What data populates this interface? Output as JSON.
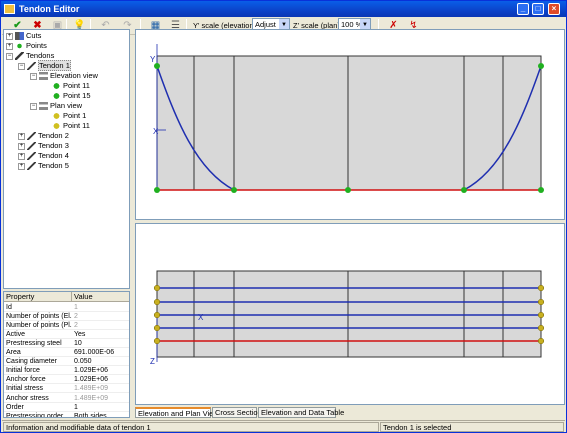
{
  "window": {
    "title": "Tendon Editor",
    "min": "_",
    "max": "□",
    "close": "×"
  },
  "toolbar": {
    "elevation_label": "Y' scale (elevation)",
    "elevation_value": "Adjust",
    "plan_label": "Z' scale (plan)",
    "plan_value": "100 %",
    "icons": [
      "check-icon",
      "delete-icon",
      "copy-icon",
      "bulb-icon",
      "undo-icon",
      "redo-icon",
      "calculator-icon",
      "list-icon",
      "ruler-cross-icon",
      "ruler-icon"
    ]
  },
  "tree": {
    "items": [
      {
        "label": "Cuts",
        "level": 0,
        "pm": "+"
      },
      {
        "label": "Points",
        "level": 0,
        "pm": "+"
      },
      {
        "label": "Tendons",
        "level": 0,
        "pm": "−"
      },
      {
        "label": "Tendon 1",
        "level": 1,
        "pm": "−"
      },
      {
        "label": "Elevation view",
        "level": 2,
        "pm": "−"
      },
      {
        "label": "Point 11",
        "level": 3,
        "pm": ""
      },
      {
        "label": "Point 15",
        "level": 3,
        "pm": ""
      },
      {
        "label": "Plan view",
        "level": 2,
        "pm": "−"
      },
      {
        "label": "Point 1",
        "level": 3,
        "pm": ""
      },
      {
        "label": "Point 11",
        "level": 3,
        "pm": ""
      },
      {
        "label": "Tendon 2",
        "level": 1,
        "pm": "+"
      },
      {
        "label": "Tendon 3",
        "level": 1,
        "pm": "+"
      },
      {
        "label": "Tendon 4",
        "level": 1,
        "pm": "+"
      },
      {
        "label": "Tendon 5",
        "level": 1,
        "pm": "+"
      }
    ]
  },
  "properties": {
    "headers": [
      "Property",
      "Value"
    ],
    "rows": [
      {
        "k": "Id",
        "v": "1",
        "gray": true
      },
      {
        "k": "Number of points (El...",
        "v": "2",
        "gray": true
      },
      {
        "k": "Number of points (Pl...",
        "v": "2",
        "gray": true
      },
      {
        "k": "Active",
        "v": "Yes",
        "gray": false
      },
      {
        "k": "Prestressing steel",
        "v": "10",
        "gray": false
      },
      {
        "k": "Area",
        "v": "691.000E-06",
        "gray": false
      },
      {
        "k": "Casing diameter",
        "v": "0.050",
        "gray": false
      },
      {
        "k": "Initial force",
        "v": "1.029E+06",
        "gray": false
      },
      {
        "k": "Anchor force",
        "v": "1.029E+06",
        "gray": false
      },
      {
        "k": "Initial stress",
        "v": "1.489E+09",
        "gray": true
      },
      {
        "k": "Anchor stress",
        "v": "1.489E+09",
        "gray": true
      },
      {
        "k": "Order",
        "v": "1",
        "gray": false
      },
      {
        "k": "Prestressing order",
        "v": "Both sides",
        "gray": false
      }
    ]
  },
  "axes": {
    "y_label": "Y",
    "x_label": "X",
    "z_label": "Z"
  },
  "tabs": [
    "Elevation and Plan Views",
    "Cross Section",
    "Elevation and Data Table"
  ],
  "status": {
    "left": "Information and modifiable data of tendon 1",
    "right": "Tendon 1 is selected"
  },
  "colors": {
    "tendon_blue": "#1f2fb0",
    "tendon_red": "#d01010",
    "point_green": "#20b020",
    "point_olive": "#c8b020"
  }
}
